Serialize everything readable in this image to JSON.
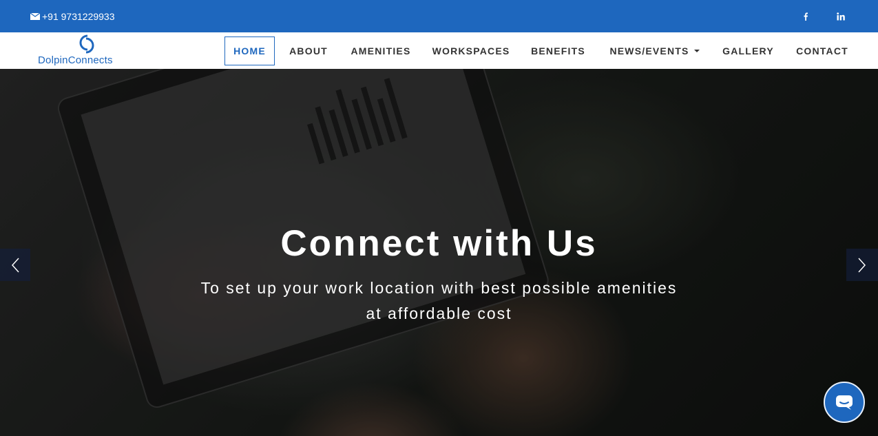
{
  "topbar": {
    "phone": "+91 9731229933",
    "icons": [
      "envelope-icon",
      "facebook-icon",
      "linkedin-icon"
    ],
    "background": "#1e67be"
  },
  "logo": {
    "text": "DolpinConnects",
    "color": "#1e67be"
  },
  "nav": {
    "items": [
      {
        "label": "HOME",
        "active": true
      },
      {
        "label": "ABOUT"
      },
      {
        "label": "AMENITIES"
      },
      {
        "label": "WORKSPACES"
      },
      {
        "label": "BENEFITS"
      },
      {
        "label": "NEWS/EVENTS"
      },
      {
        "label": "GALLERY"
      },
      {
        "label": "CONTACT"
      }
    ],
    "active_color": "#1e67be"
  },
  "hero": {
    "title": "Connect with Us",
    "subtitle_line1": "To set up your work location with best possible amenities",
    "subtitle_line2": "at affordable cost",
    "controls": [
      "chevron-left-icon",
      "chevron-right-icon"
    ]
  },
  "chat": {
    "icon": "chat-bubble-icon",
    "color": "#1e67be"
  }
}
